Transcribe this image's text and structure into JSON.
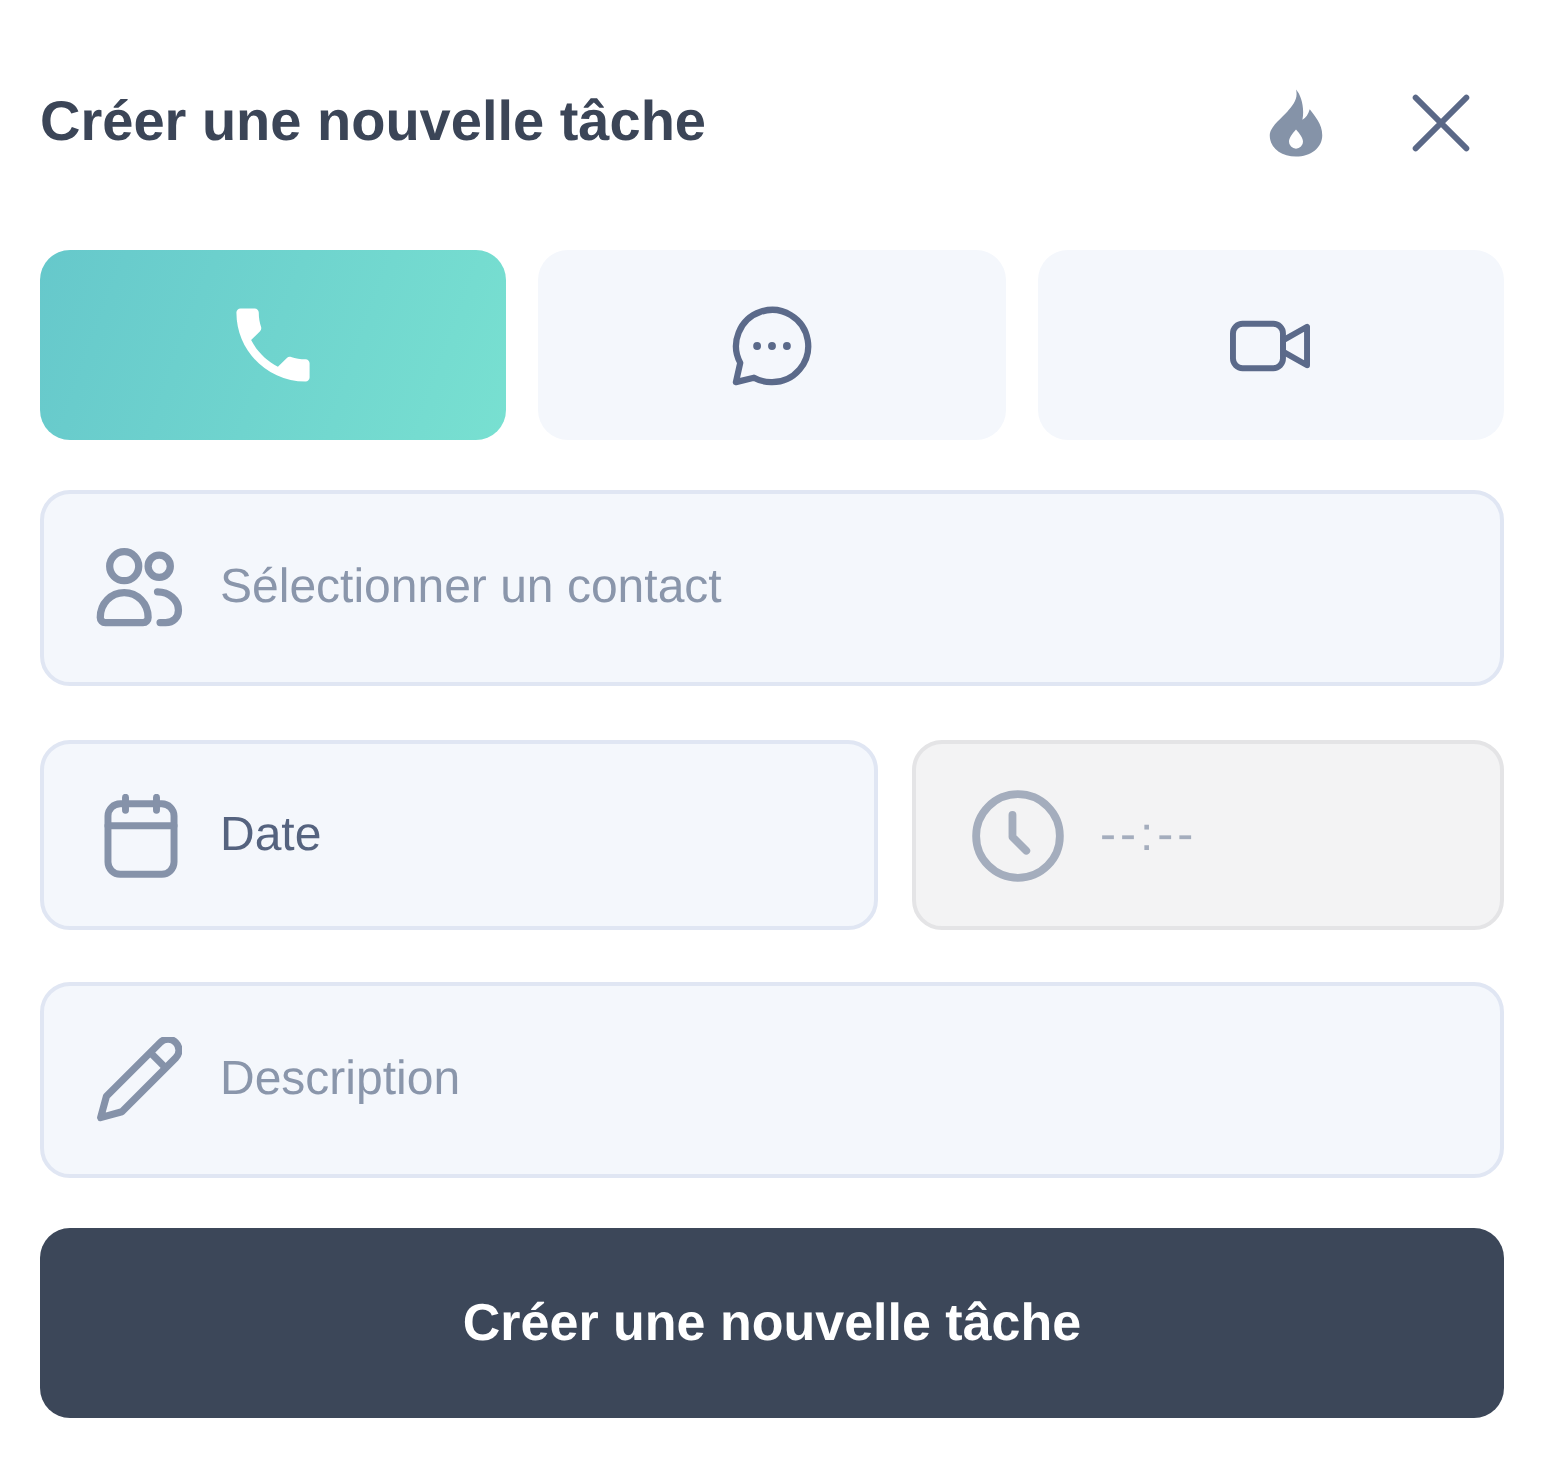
{
  "header": {
    "title": "Créer une nouvelle tâche"
  },
  "task_types": [
    {
      "kind": "call",
      "selected": true
    },
    {
      "kind": "message",
      "selected": false
    },
    {
      "kind": "video",
      "selected": false
    }
  ],
  "contact_field": {
    "placeholder": "Sélectionner un contact"
  },
  "date_field": {
    "value": "Date"
  },
  "time_field": {
    "placeholder": "--:--",
    "disabled": true
  },
  "description_field": {
    "placeholder": "Description"
  },
  "submit_button": {
    "label": "Créer une nouvelle tâche"
  }
}
